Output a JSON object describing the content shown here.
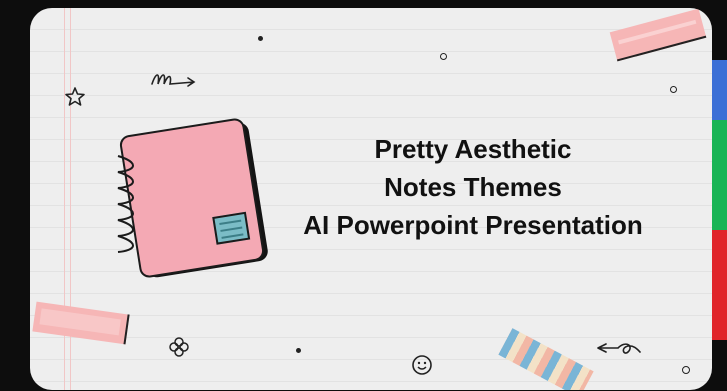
{
  "slide": {
    "title_lines": [
      "Pretty Aesthetic",
      "Notes Themes",
      "AI Powerpoint Presentation"
    ]
  },
  "colors": {
    "background": "#eeeeee",
    "notebook": "#f4a9b4",
    "notebook_label": "#7bbcc6",
    "tape_pink": "#f6b6b6",
    "side_blue": "#3b6fd6",
    "side_green": "#18b455",
    "side_red": "#e0242a"
  },
  "icons": [
    "star-icon",
    "squiggle-arrow-icon",
    "flower-icon",
    "smiley-icon",
    "curl-arrow-icon",
    "spiral-icon",
    "dot-icon"
  ]
}
